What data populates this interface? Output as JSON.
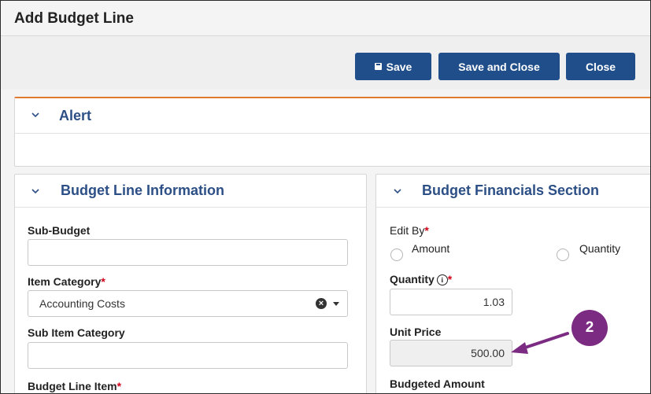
{
  "dialog": {
    "title": "Add Budget Line"
  },
  "toolbar": {
    "save_label": "Save",
    "save_close_label": "Save and Close",
    "close_label": "Close"
  },
  "alert": {
    "title": "Alert"
  },
  "info": {
    "title": "Budget Line Information",
    "sub_budget_label": "Sub-Budget",
    "sub_budget_value": "",
    "item_category_label": "Item Category",
    "item_category_value": "Accounting Costs",
    "sub_item_category_label": "Sub Item Category",
    "sub_item_category_value": "",
    "budget_line_item_label": "Budget Line Item",
    "required_mark": "*"
  },
  "financials": {
    "title": "Budget Financials Section",
    "edit_by_label": "Edit By",
    "radio_amount_label": "Amount",
    "radio_quantity_label": "Quantity",
    "quantity_label": "Quantity",
    "quantity_value": "1.03",
    "unit_price_label": "Unit Price",
    "unit_price_value": "500.00",
    "budgeted_amount_label": "Budgeted Amount",
    "required_mark": "*"
  },
  "annotation": {
    "callout_number": "2",
    "color": "#7b2b82"
  },
  "colors": {
    "primary_button": "#1f4e8a",
    "section_title": "#2c4f86",
    "alert_accent": "#e07a2e",
    "required": "#d0021b"
  }
}
